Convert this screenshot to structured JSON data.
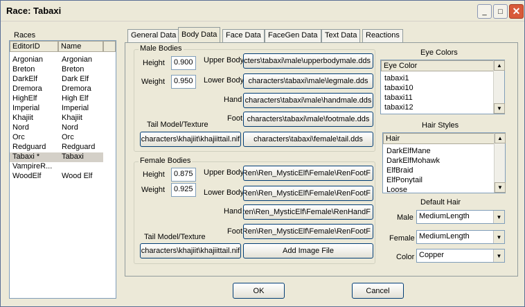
{
  "window": {
    "title": "Race: Tabaxi",
    "close_glyph": "✕",
    "minimize_glyph": "_",
    "maximize_glyph": "□"
  },
  "races": {
    "label": "Races",
    "col_editorid": "EditorID",
    "col_name": "Name",
    "rows": [
      {
        "id": "Argonian",
        "name": "Argonian"
      },
      {
        "id": "Breton",
        "name": "Breton"
      },
      {
        "id": "DarkElf",
        "name": "Dark Elf"
      },
      {
        "id": "Dremora",
        "name": "Dremora"
      },
      {
        "id": "HighElf",
        "name": "High Elf"
      },
      {
        "id": "Imperial",
        "name": "Imperial"
      },
      {
        "id": "Khajiit",
        "name": "Khajiit"
      },
      {
        "id": "Nord",
        "name": "Nord"
      },
      {
        "id": "Orc",
        "name": "Orc"
      },
      {
        "id": "Redguard",
        "name": "Redguard"
      },
      {
        "id": "Tabaxi *",
        "name": "Tabaxi"
      },
      {
        "id": "VampireR...",
        "name": ""
      },
      {
        "id": "WoodElf",
        "name": "Wood Elf"
      }
    ]
  },
  "tabs": [
    "General Data",
    "Body Data",
    "Face Data",
    "FaceGen Data",
    "Text Data",
    "Reactions"
  ],
  "male": {
    "legend": "Male Bodies",
    "height_label": "Height",
    "height": "0.900",
    "weight_label": "Weight",
    "weight": "0.950",
    "upper_label": "Upper Body",
    "upper": "characters\\tabaxi\\male\\upperbodymale.dds",
    "lower_label": "Lower Body",
    "lower": "characters\\tabaxi\\male\\legmale.dds",
    "hand_label": "Hand",
    "hand": "characters\\tabaxi\\male\\handmale.dds",
    "foot_label": "Foot",
    "foot": "characters\\tabaxi\\male\\footmale.dds",
    "tail_label": "Tail Model/Texture",
    "tail_model": "characters\\khajiit\\khajiittail.nif",
    "tail_texture": "characters\\tabaxi\\female\\tail.dds"
  },
  "female": {
    "legend": "Female Bodies",
    "height_label": "Height",
    "height": "0.875",
    "weight_label": "Weight",
    "weight": "0.925",
    "upper_label": "Upper Body",
    "upper": "\\Ren\\Ren_MysticElf\\Female\\RenFootF",
    "lower_label": "Lower Body",
    "lower": "\\Ren\\Ren_MysticElf\\Female\\RenFootF",
    "hand_label": "Hand",
    "hand": "\\Ren\\Ren_MysticElf\\Female\\RenHandF",
    "foot_label": "Foot",
    "foot": "\\Ren\\Ren_MysticElf\\Female\\RenFootF",
    "tail_label": "Tail Model/Texture",
    "tail_model": "characters\\khajiit\\khajiittail.nif",
    "add_image": "Add Image File"
  },
  "eye_colors": {
    "title": "Eye Colors",
    "header": "Eye Color",
    "items": [
      "tabaxi1",
      "tabaxi10",
      "tabaxi11",
      "tabaxi12"
    ]
  },
  "hair_styles": {
    "title": "Hair Styles",
    "header": "Hair",
    "items": [
      "DarkElfMane",
      "DarkElfMohawk",
      "ElfBraid",
      "ElfPonytail",
      "Loose"
    ]
  },
  "default_hair": {
    "title": "Default Hair",
    "male_label": "Male",
    "male": "MediumLength",
    "female_label": "Female",
    "female": "MediumLength",
    "color_label": "Color",
    "color": "Copper"
  },
  "buttons": {
    "ok": "OK",
    "cancel": "Cancel"
  }
}
